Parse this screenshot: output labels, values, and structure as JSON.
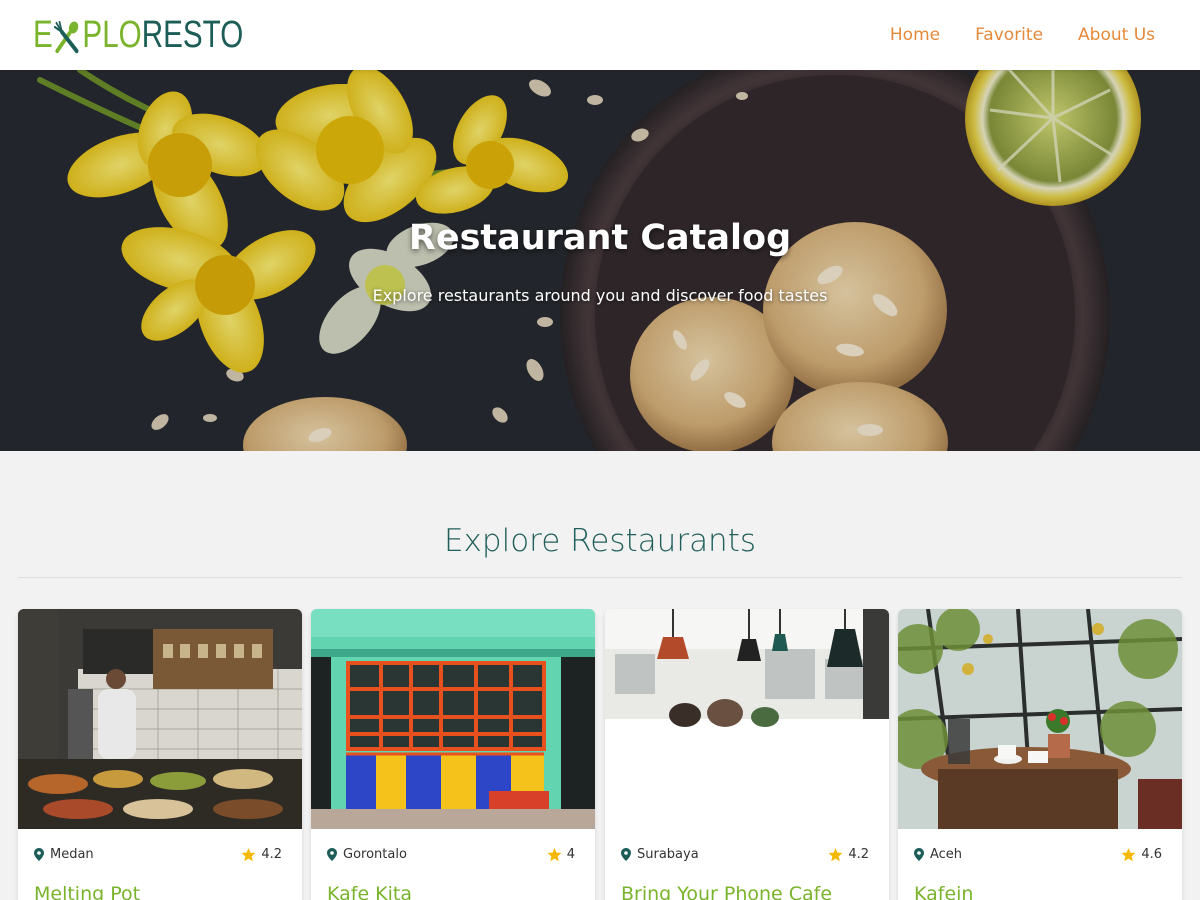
{
  "header": {
    "logo_part1": "E",
    "logo_part2": "PLO",
    "logo_part3": "RESTO",
    "nav": [
      {
        "label": "Home",
        "icon": ""
      },
      {
        "label": "Favorite",
        "icon": ""
      },
      {
        "label": "About Us",
        "icon": ""
      }
    ]
  },
  "hero": {
    "title": "Restaurant Catalog",
    "subtitle": "Explore restaurants around you and discover food tastes"
  },
  "section": {
    "title": "Explore Restaurants"
  },
  "restaurants": [
    {
      "city": "Medan",
      "rating": "4.2",
      "name": "Melting Pot"
    },
    {
      "city": "Gorontalo",
      "rating": "4",
      "name": "Kafe Kita"
    },
    {
      "city": "Surabaya",
      "rating": "4.2",
      "name": "Bring Your Phone Cafe"
    },
    {
      "city": "Aceh",
      "rating": "4.6",
      "name": "Kafein"
    }
  ],
  "icons": {
    "location": "map-pin-icon",
    "rating": "star-icon",
    "logo": "fork-spoon-icon"
  },
  "colors": {
    "brand_green": "#79b42c",
    "brand_teal": "#1c5d57",
    "nav_orange": "#e58a3a",
    "star_yellow": "#f5b800",
    "background": "#f2f2f2"
  }
}
